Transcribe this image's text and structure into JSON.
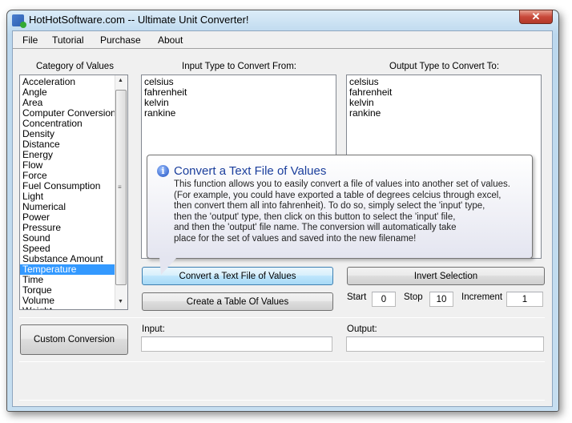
{
  "window": {
    "title": "HotHotSoftware.com -- Ultimate Unit Converter!",
    "close_label": "✕"
  },
  "menu": {
    "items": [
      "File",
      "Tutorial",
      "Purchase",
      "About"
    ]
  },
  "category": {
    "label": "Category of Values",
    "items": [
      "Acceleration",
      "Angle",
      "Area",
      "Computer Conversions",
      "Concentration",
      "Density",
      "Distance",
      "Energy",
      "Flow",
      "Force",
      "Fuel Consumption",
      "Light",
      "Numerical",
      "Power",
      "Pressure",
      "Sound",
      "Speed",
      "Substance Amount",
      "Temperature",
      "Time",
      "Torque",
      "Volume",
      "Weight"
    ],
    "selected": "Temperature"
  },
  "input_types": {
    "label": "Input Type to Convert From:",
    "items": [
      "celsius",
      "fahrenheit",
      "kelvin",
      "rankine"
    ]
  },
  "output_types": {
    "label": "Output Type to Convert To:",
    "items": [
      "celsius",
      "fahrenheit",
      "kelvin",
      "rankine"
    ]
  },
  "tooltip": {
    "title": "Convert a Text File of Values",
    "lines": [
      "This function allows you to easily convert a file of values into another set of values.",
      "(For example, you could have exported a table of degrees celcius through excel,",
      "then convert them all into fahrenheit). To do so, simply select the 'input' type,",
      "then the 'output' type, then click on this button to select the 'input' file,",
      "and then the 'output' file name. The conversion will automatically take",
      "place for the set of values and saved into the new filename!"
    ],
    "icon": "info-icon"
  },
  "buttons": {
    "convert_file": "Convert a Text File of Values",
    "invert": "Invert Selection",
    "create_table": "Create a Table Of Values",
    "custom": "Custom Conversion"
  },
  "table": {
    "start_label": "Start",
    "start": "0",
    "stop_label": "Stop",
    "stop": "10",
    "increment_label": "Increment",
    "increment": "1"
  },
  "fields": {
    "input_label": "Input:",
    "input_value": "",
    "output_label": "Output:",
    "output_value": ""
  }
}
